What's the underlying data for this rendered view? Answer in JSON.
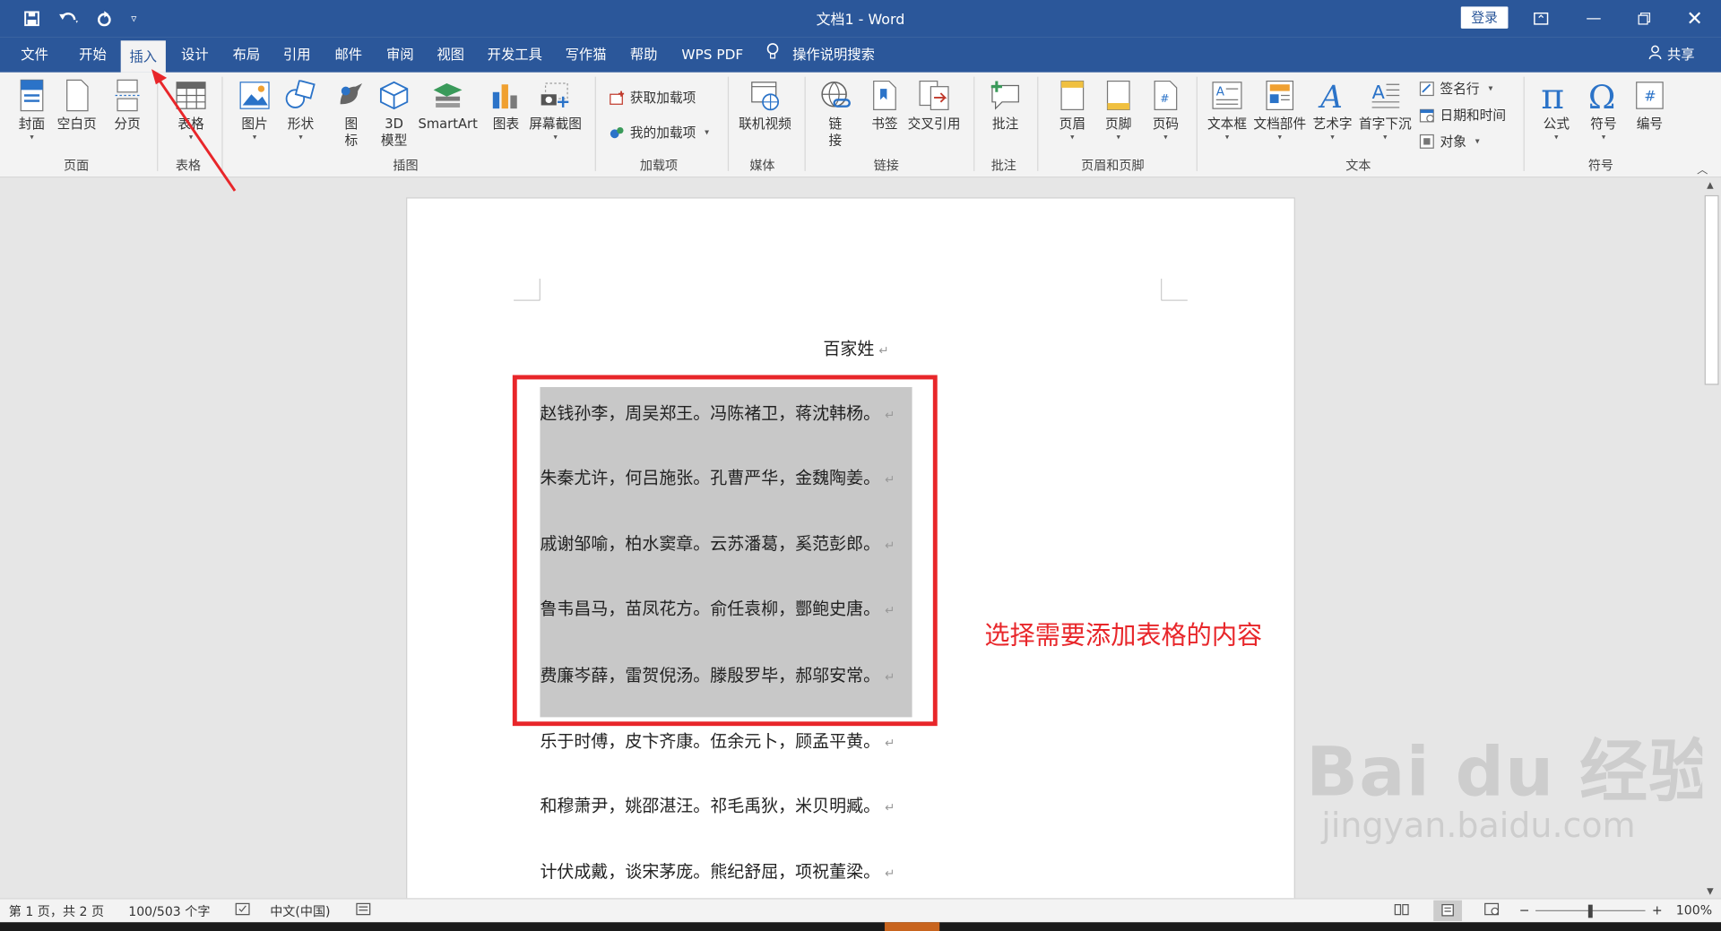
{
  "titlebar": {
    "doc_title": "文档1 - Word",
    "login_label": "登录"
  },
  "tabs": [
    {
      "label": "文件"
    },
    {
      "label": "开始"
    },
    {
      "label": "插入"
    },
    {
      "label": "设计"
    },
    {
      "label": "布局"
    },
    {
      "label": "引用"
    },
    {
      "label": "邮件"
    },
    {
      "label": "审阅"
    },
    {
      "label": "视图"
    },
    {
      "label": "开发工具"
    },
    {
      "label": "写作猫"
    },
    {
      "label": "帮助"
    },
    {
      "label": "WPS PDF"
    }
  ],
  "tellme": "操作说明搜索",
  "share": "共享",
  "ribbon": {
    "page": {
      "group": "页面",
      "cover": "封面",
      "blank": "空白页",
      "break": "分页"
    },
    "table": {
      "group": "表格",
      "table": "表格"
    },
    "illustrations": {
      "group": "插图",
      "picture": "图片",
      "shapes": "形状",
      "icons_1": "图",
      "icons_2": "标",
      "model_1": "3D",
      "model_2": "模型",
      "smartart": "SmartArt",
      "chart": "图表",
      "screenshot": "屏幕截图"
    },
    "addins": {
      "group": "加载项",
      "get": "获取加载项",
      "mine": "我的加载项"
    },
    "media": {
      "group": "媒体",
      "video": "联机视频"
    },
    "links": {
      "group": "链接",
      "link_1": "链",
      "link_2": "接",
      "bookmark": "书签",
      "crossref": "交叉引用"
    },
    "comments": {
      "group": "批注",
      "comment": "批注"
    },
    "headerfooter": {
      "group": "页眉和页脚",
      "header": "页眉",
      "footer": "页脚",
      "pagenum": "页码"
    },
    "text": {
      "group": "文本",
      "textbox": "文本框",
      "parts": "文档部件",
      "wordart": "艺术字",
      "dropcap": "首字下沉",
      "sigline": "签名行",
      "datetime": "日期和时间",
      "object": "对象"
    },
    "symbols": {
      "group": "符号",
      "equation": "公式",
      "symbol": "符号",
      "number": "编号"
    }
  },
  "document": {
    "title": "百家姓",
    "lines": [
      "赵钱孙李，周吴郑王。冯陈褚卫，蒋沈韩杨。",
      "朱秦尤许，何吕施张。孔曹严华，金魏陶姜。",
      "戚谢邹喻，柏水窦章。云苏潘葛，奚范彭郎。",
      "鲁韦昌马，苗凤花方。俞任袁柳，酆鲍史唐。",
      "费廉岑薛，雷贺倪汤。滕殷罗毕，郝邬安常。",
      "乐于时傅，皮卞齐康。伍余元卜，顾孟平黄。",
      "和穆萧尹，姚邵湛汪。祁毛禹狄，米贝明臧。",
      "计伏成戴，谈宋茅庞。熊纪舒屈，项祝董梁。"
    ],
    "para_mark": "↵",
    "annotation": "选择需要添加表格的内容"
  },
  "status": {
    "page": "第 1 页，共 2 页",
    "words": "100/503 个字",
    "language": "中文(中国)",
    "zoom": "100%"
  },
  "watermark": {
    "big": "Bai du 经验",
    "small": "jingyan.baidu.com"
  },
  "colors": {
    "accent": "#2b579a",
    "highlight": "#e8262a",
    "selection": "#c8c8c8"
  }
}
